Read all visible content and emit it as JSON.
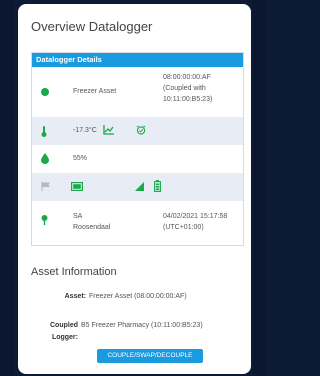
{
  "page_title": "Overview Datalogger",
  "details": {
    "header": "Datalogger Details",
    "rows": {
      "status": {
        "name": "Freezer Asset",
        "id_line1": "08:00:00:00:AF",
        "id_line2": "(Coupled with",
        "id_line3": "10:11:00:B5:23)",
        "status_color": "#1aa84a"
      },
      "temperature": {
        "value": "-17.3°C"
      },
      "humidity": {
        "value": "55%"
      },
      "location": {
        "name_line1": "SA",
        "name_line2": "Roosendaal",
        "time_line1": "04/02/2021 15:17:58",
        "time_line2": "(UTC+01:00)"
      }
    }
  },
  "asset_info": {
    "title": "Asset Information",
    "asset_label": "Asset:",
    "asset_value": "Freezer Asset (08:00:00:00:AF)",
    "coupled_label_line1": "Coupled",
    "coupled_label_line2": "Logger:",
    "coupled_value": "B5 Freezer Pharmacy (10:11:00:B5:23)",
    "button_label": "COUPLE/SWAP/DECOUPLE"
  },
  "colors": {
    "accent": "#1a9be0",
    "ok": "#1aa84a",
    "row_alt": "#e8edf5"
  }
}
